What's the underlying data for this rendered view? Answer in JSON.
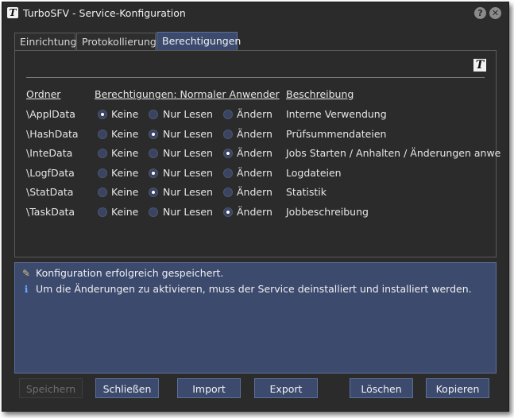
{
  "window": {
    "title": "TurboSFV - Service-Konfiguration",
    "help_glyph": "?",
    "close_glyph": "✕",
    "app_icon": "T"
  },
  "tabs": [
    {
      "label": "Einrichtung"
    },
    {
      "label": "Protokollierung"
    },
    {
      "label": "Berechtigungen"
    }
  ],
  "panel": {
    "logo_glyph": "T",
    "headers": {
      "folder": "Ordner",
      "permissions": "Berechtigungen: Normaler Anwender",
      "description": "Beschreibung"
    },
    "options": {
      "none": "Keine",
      "read": "Nur Lesen",
      "change": "Ändern"
    },
    "rows": [
      {
        "folder": "\\ApplData",
        "selected": "none",
        "description": "Interne Verwendung"
      },
      {
        "folder": "\\HashData",
        "selected": "read",
        "description": "Prüfsummendateien"
      },
      {
        "folder": "\\InteData",
        "selected": "change",
        "description": "Jobs Starten / Anhalten / Änderungen anwe"
      },
      {
        "folder": "\\LogfData",
        "selected": "read",
        "description": "Logdateien"
      },
      {
        "folder": "\\StatData",
        "selected": "read",
        "description": "Statistik"
      },
      {
        "folder": "\\TaskData",
        "selected": "change",
        "description": "Jobbeschreibung"
      }
    ]
  },
  "messages": [
    {
      "icon": "success-pen-icon",
      "glyph": "✎",
      "text": "Konfiguration erfolgreich gespeichert."
    },
    {
      "icon": "info-icon",
      "glyph": "ℹ",
      "text": "Um die Änderungen zu aktivieren, muss der Service deinstalliert und installiert werden."
    }
  ],
  "buttons": {
    "save": "Speichern",
    "close": "Schließen",
    "import": "Import",
    "export": "Export",
    "delete": "Löschen",
    "copy": "Kopieren"
  },
  "colors": {
    "accent": "#3c4a6e",
    "background": "#2b2b2b",
    "accent_border": "#5f6f99"
  }
}
